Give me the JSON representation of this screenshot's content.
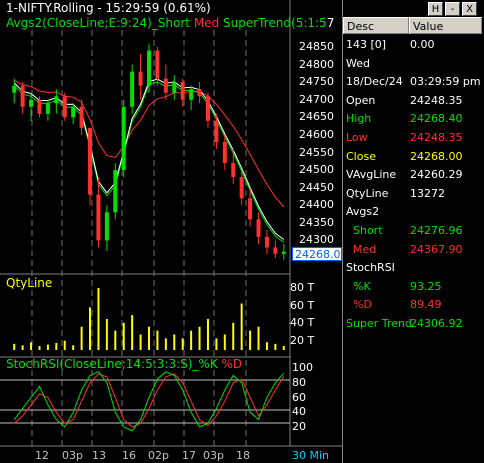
{
  "chart": {
    "title": "1-NIFTY.Rolling - 15:29:59 (0.61%)",
    "avg_legend": {
      "name": "Avgs2(CloseLine;E:9:24)_Short",
      "short": "Short",
      "med": "Med",
      "supertrend": "SuperTrend(5:1:5",
      "extra": "7"
    },
    "price_ticks": [
      "24850",
      "24800",
      "24750",
      "24700",
      "24650",
      "24600",
      "24550",
      "24500",
      "24450",
      "24400",
      "24350",
      "24300",
      "24250"
    ],
    "current_price_tag": "24268.00",
    "qty_label": "QtyLine",
    "qty_ticks": [
      "80 T",
      "60 T",
      "40 T",
      "20 T"
    ],
    "rsi_legend": {
      "name": "StochRSI(CloseLine;14:5:3:3:S)_%K",
      "d": "%D"
    },
    "rsi_ticks": [
      "100",
      "80",
      "60",
      "40",
      "20"
    ],
    "x_labels": [
      "12",
      "03p",
      "13",
      "16",
      "02p",
      "17",
      "03p",
      "18"
    ],
    "interval": "30 Min",
    "colors": {
      "short": "#00e000",
      "med": "#ff3030",
      "supertrend": "#00e000",
      "qty": "#ffff00",
      "price_tag": "#0060ff"
    }
  },
  "chart_data": {
    "type": "candlestick",
    "ylim": [
      24230,
      24870
    ],
    "candles": [
      [
        24720,
        24760,
        24690,
        24740
      ],
      [
        24740,
        24750,
        24660,
        24680
      ],
      [
        24680,
        24720,
        24640,
        24700
      ],
      [
        24700,
        24710,
        24650,
        24660
      ],
      [
        24660,
        24700,
        24640,
        24690
      ],
      [
        24690,
        24730,
        24660,
        24710
      ],
      [
        24710,
        24720,
        24640,
        24650
      ],
      [
        24650,
        24690,
        24630,
        24680
      ],
      [
        24680,
        24700,
        24600,
        24620
      ],
      [
        24620,
        24580,
        24400,
        24430
      ],
      [
        24430,
        24480,
        24280,
        24300
      ],
      [
        24300,
        24400,
        24270,
        24380
      ],
      [
        24380,
        24520,
        24360,
        24500
      ],
      [
        24500,
        24700,
        24480,
        24680
      ],
      [
        24680,
        24800,
        24660,
        24780
      ],
      [
        24780,
        24830,
        24700,
        24740
      ],
      [
        24740,
        24860,
        24720,
        24840
      ],
      [
        24840,
        24850,
        24740,
        24760
      ],
      [
        24760,
        24800,
        24700,
        24720
      ],
      [
        24720,
        24770,
        24700,
        24750
      ],
      [
        24750,
        24760,
        24680,
        24700
      ],
      [
        24700,
        24740,
        24670,
        24730
      ],
      [
        24730,
        24750,
        24690,
        24710
      ],
      [
        24710,
        24720,
        24620,
        24640
      ],
      [
        24640,
        24660,
        24560,
        24580
      ],
      [
        24580,
        24600,
        24500,
        24520
      ],
      [
        24520,
        24560,
        24460,
        24480
      ],
      [
        24480,
        24500,
        24400,
        24420
      ],
      [
        24420,
        24450,
        24340,
        24360
      ],
      [
        24360,
        24380,
        24290,
        24310
      ],
      [
        24310,
        24330,
        24260,
        24280
      ],
      [
        24280,
        24300,
        24250,
        24262
      ],
      [
        24262,
        24290,
        24245,
        24268
      ]
    ],
    "qty": [
      8,
      6,
      10,
      5,
      7,
      9,
      12,
      6,
      30,
      55,
      80,
      40,
      25,
      35,
      45,
      20,
      30,
      25,
      15,
      20,
      15,
      25,
      30,
      40,
      15,
      20,
      35,
      60,
      25,
      30,
      10,
      8,
      5
    ],
    "stoch_k": [
      30,
      45,
      60,
      75,
      50,
      30,
      20,
      40,
      70,
      90,
      95,
      80,
      40,
      20,
      15,
      30,
      60,
      85,
      95,
      90,
      70,
      40,
      20,
      25,
      45,
      70,
      90,
      80,
      40,
      30,
      60,
      80,
      93
    ],
    "stoch_d": [
      25,
      35,
      50,
      65,
      60,
      40,
      25,
      30,
      55,
      80,
      92,
      88,
      60,
      30,
      20,
      25,
      45,
      70,
      88,
      92,
      80,
      55,
      30,
      22,
      35,
      55,
      80,
      85,
      60,
      35,
      50,
      70,
      89
    ]
  },
  "panel": {
    "buttons": [
      "H",
      "-",
      "X"
    ],
    "header": {
      "desc": "Desc",
      "value": "Value"
    },
    "rows": [
      {
        "desc": "143 [0]",
        "value": "0.00",
        "color": "#ffffff"
      },
      {
        "desc": "Wed",
        "value": "",
        "color": "#ffffff"
      },
      {
        "desc": "18/Dec/24",
        "value": "03:29:59 pm",
        "color": "#ffffff"
      },
      {
        "desc": "Open",
        "value": "24248.35",
        "color": "#ffffff"
      },
      {
        "desc": "High",
        "value": "24268.40",
        "color": "#00e000"
      },
      {
        "desc": "Low",
        "value": "24248.35",
        "color": "#ff3030"
      },
      {
        "desc": "Close",
        "value": "24268.00",
        "color": "#ffff00"
      },
      {
        "desc": "VAvgLine",
        "value": "24260.29",
        "color": "#ffffff"
      },
      {
        "desc": "QtyLine",
        "value": "13272",
        "color": "#ffffff"
      },
      {
        "desc": "Avgs2",
        "value": "",
        "color": "#ffffff"
      },
      {
        "desc": "  Short",
        "value": "24276.96",
        "color": "#00e000"
      },
      {
        "desc": "  Med",
        "value": "24367.90",
        "color": "#ff3030"
      },
      {
        "desc": "StochRSI",
        "value": "",
        "color": "#ffffff"
      },
      {
        "desc": "  %K",
        "value": "93.25",
        "color": "#00e000"
      },
      {
        "desc": "  %D",
        "value": "89.49",
        "color": "#ff3030"
      },
      {
        "desc": "Super Trend",
        "value": "24306.92",
        "color": "#00e000"
      }
    ]
  }
}
